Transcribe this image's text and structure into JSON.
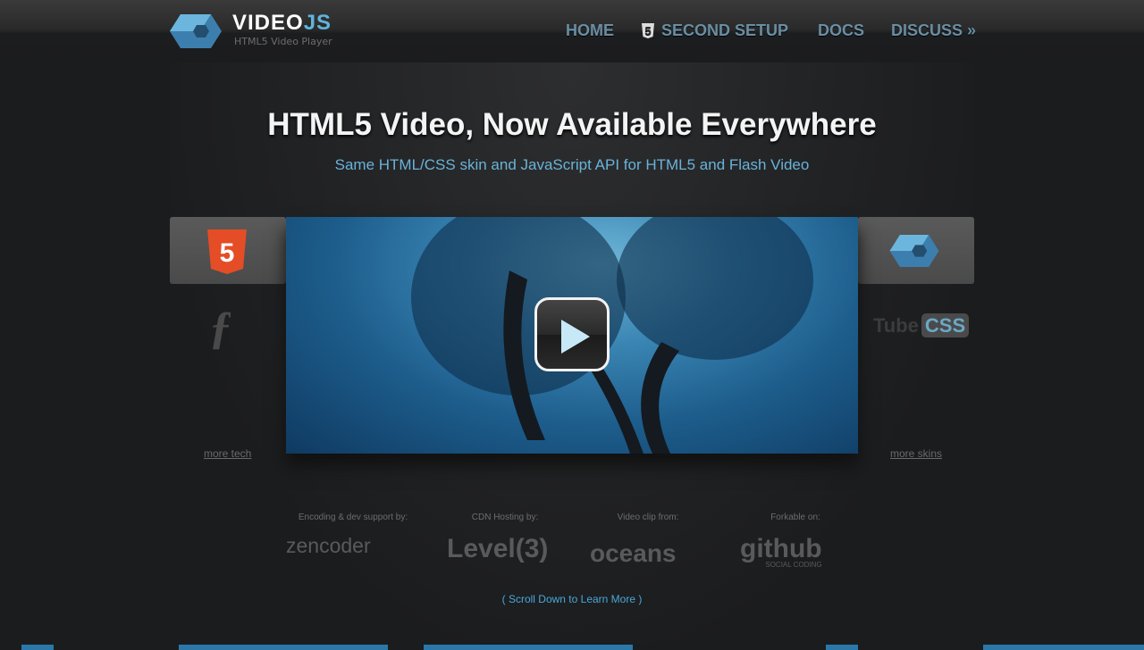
{
  "header": {
    "brand_main": "VIDEO",
    "brand_accent": "JS",
    "tagline": "HTML5 Video Player",
    "nav": [
      {
        "label": "HOME"
      },
      {
        "badge": "5",
        "label": "SECOND SETUP"
      },
      {
        "label": "DOCS"
      },
      {
        "label": "DISCUSS »"
      }
    ]
  },
  "hero": {
    "title": "HTML5 Video, Now Available Everywhere",
    "subtitle": "Same HTML/CSS skin and JavaScript API for HTML5 and Flash Video"
  },
  "tech": {
    "html5_badge": "5",
    "more_label": "more tech"
  },
  "skins": {
    "tube": "Tube",
    "css": "CSS",
    "more_label": "more skins"
  },
  "partners": [
    {
      "label": "Encoding & dev support by:",
      "name": "zencoder"
    },
    {
      "label": "CDN Hosting by:",
      "name": "Level(3)"
    },
    {
      "label": "Video clip from:",
      "name": "oceans"
    },
    {
      "label": "Forkable on:",
      "name": "github",
      "sub": "SOCIAL CODING"
    }
  ],
  "scroll_label": "( Scroll Down to Learn More )",
  "colors": {
    "accent": "#5fb4dc",
    "html5": "#e44d26",
    "background": "#1b1c1e"
  }
}
